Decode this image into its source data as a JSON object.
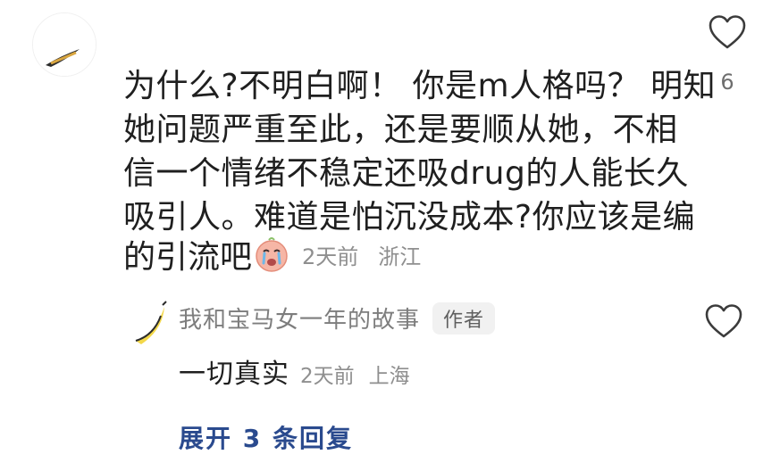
{
  "comment": {
    "username": "·　  ·",
    "text_lines": [
      "为什么?不明白啊！ 你是m人格吗？ 明知",
      "她问题严重至此，还是要顺从她，不相",
      "信一个情绪不稳定还吸drug的人能长久",
      "吸引人。难道是怕沉没成本?你应该是编"
    ],
    "last_line": "的引流吧",
    "emoji_icon": "crying-face-emoji",
    "time": "2天前",
    "location": "浙江",
    "like_count": "6",
    "like_icon": "heart-outline-icon"
  },
  "reply": {
    "username": "我和宝马女一年的故事",
    "author_badge": "作者",
    "text": "一切真实",
    "time": "2天前",
    "location": "上海",
    "like_icon": "heart-outline-icon"
  },
  "expand_replies": "展开 3 条回复",
  "colors": {
    "text": "#1f1f1f",
    "meta": "#8f8f8f",
    "link": "#2a4a8e",
    "badge_bg": "#f1f1f1"
  }
}
